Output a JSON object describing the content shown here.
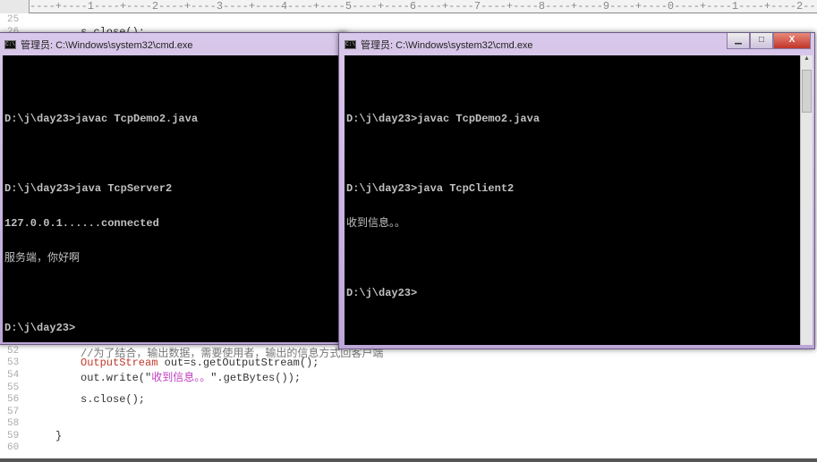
{
  "editor": {
    "ruler": "----+----1----+----2----+----3----+----4----+----5----+----6----+----7----+----8----+----9----+----0----+----1----+----2--",
    "lines": [
      {
        "n": "25",
        "code": ""
      },
      {
        "n": "26",
        "code": "s.close();"
      },
      {
        "n": "52",
        "code": "//为了结合，输出数据，需要使用者，输出的信息方式回客户端"
      },
      {
        "n": "53",
        "kw": "OutputStream",
        "code": " out=s.getOutputStream();"
      },
      {
        "n": "54",
        "pre": "out.write(\"",
        "str": "收到信息。。",
        "post": "\".getBytes());"
      },
      {
        "n": "55",
        "code": ""
      },
      {
        "n": "56",
        "code": "s.close();"
      },
      {
        "n": "57",
        "code": ""
      },
      {
        "n": "58",
        "code": ""
      },
      {
        "n": "59",
        "code": "}"
      },
      {
        "n": "60",
        "code": ""
      }
    ]
  },
  "server_window": {
    "title": "管理员: C:\\Windows\\system32\\cmd.exe",
    "icon_label": "C:\\",
    "lines": [
      "",
      "D:\\j\\day23>javac TcpDemo2.java",
      "",
      "D:\\j\\day23>java TcpServer2",
      "127.0.0.1......connected",
      "服务端，你好啊",
      "",
      "D:\\j\\day23>"
    ]
  },
  "client_window": {
    "title": "管理员: C:\\Windows\\system32\\cmd.exe",
    "icon_label": "C:\\",
    "lines": [
      "",
      "D:\\j\\day23>javac TcpDemo2.java",
      "",
      "D:\\j\\day23>java TcpClient2",
      "收到信息。。",
      "",
      "D:\\j\\day23>"
    ],
    "minimize": "▁",
    "maximize": "□",
    "close": "X"
  }
}
